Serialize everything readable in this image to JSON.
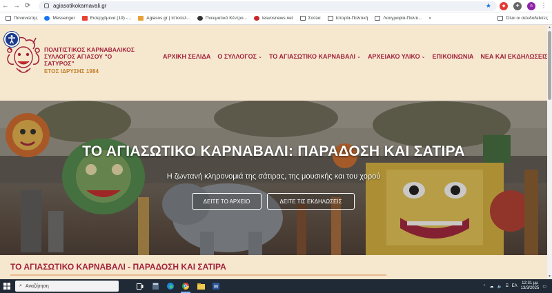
{
  "browser": {
    "url": "agiasotikokarnavali.gr",
    "profile_initial": "n"
  },
  "bookmarks": [
    {
      "label": "Πανανιώτης",
      "type": "folder"
    },
    {
      "label": "Messenger",
      "type": "messenger"
    },
    {
      "label": "Εισερχόμενα (19) -...",
      "type": "gmail"
    },
    {
      "label": "Agiasos.gr | Ιστοσελ...",
      "type": "site"
    },
    {
      "label": "Πνευματικό Κέντρο...",
      "type": "site"
    },
    {
      "label": "lesvosnews.net",
      "type": "site"
    },
    {
      "label": "Σούλα",
      "type": "folder"
    },
    {
      "label": "Ιστορία-Πολιτική",
      "type": "folder"
    },
    {
      "label": "Λαογραφία-Πολιτι...",
      "type": "folder"
    }
  ],
  "bookmarks_all": "Όλοι οι σελιδοδείκτες",
  "brand": {
    "line1": "ΠΟΛΙΤΙΣΤΙΚΟΣ ΚΑΡΝΑΒΑΛΙΚΟΣ",
    "line2": "ΣΥΛΛΟΓΟΣ ΑΓΙΑΣΟΥ \"Ο ΣΑΤΥΡΟΣ\"",
    "since": "ΕΤΟΣ ΙΔΡΥΣΗΣ 1984"
  },
  "menu": [
    {
      "label": "ΑΡΧΙΚΗ ΣΕΛΙΔΑ",
      "dropdown": false
    },
    {
      "label": "Ο ΣΥΛΛΟΓΟΣ",
      "dropdown": true
    },
    {
      "label": "ΤΟ ΑΓΙΑΣΩΤΙΚΟ ΚΑΡΝΑΒΑΛΙ",
      "dropdown": true
    },
    {
      "label": "ΑΡΧΕΙΑΚΟ ΥΛΙΚΟ",
      "dropdown": true
    },
    {
      "label": "ΕΠΙΚΟΙΝΩΝΙΑ",
      "dropdown": false
    },
    {
      "label": "ΝΕΑ ΚΑΙ ΕΚΔΗΛΩΣΕΙΣ",
      "dropdown": false
    }
  ],
  "hero": {
    "title": "ΤΟ ΑΓΙΑΣΩΤΙΚΟ ΚΑΡΝΑΒΑΛΙ: ΠΑΡΑΔΟΣΗ ΚΑΙ ΣΑΤΙΡΑ",
    "subtitle": "Η ζωντανή κληρονομιά της σάτιρας, της μουσικής και του χορού",
    "btn_archive": "ΔΕΙΤΕ ΤΟ ΑΡΧΕΙΟ",
    "btn_events": "ΔΕΙΤΕ ΤΙΣ ΕΚΔΗΛΩΣΕΙΣ"
  },
  "section": {
    "title": "ΤΟ ΑΓΙΑΣΩΤΙΚΟ ΚΑΡΝΑΒΑΛΙ - ΠΑΡΑΔΟΣΗ ΚΑΙ ΣΑΤΙΡΑ"
  },
  "taskbar": {
    "search_placeholder": "Αναζήτηση",
    "lang": "ΕΛ",
    "time": "12:31 μμ",
    "date": "13/3/2025"
  },
  "colors": {
    "brand_red": "#a2213a",
    "header_bg": "#f6e7cf",
    "accent_gold": "#c17f2a"
  }
}
